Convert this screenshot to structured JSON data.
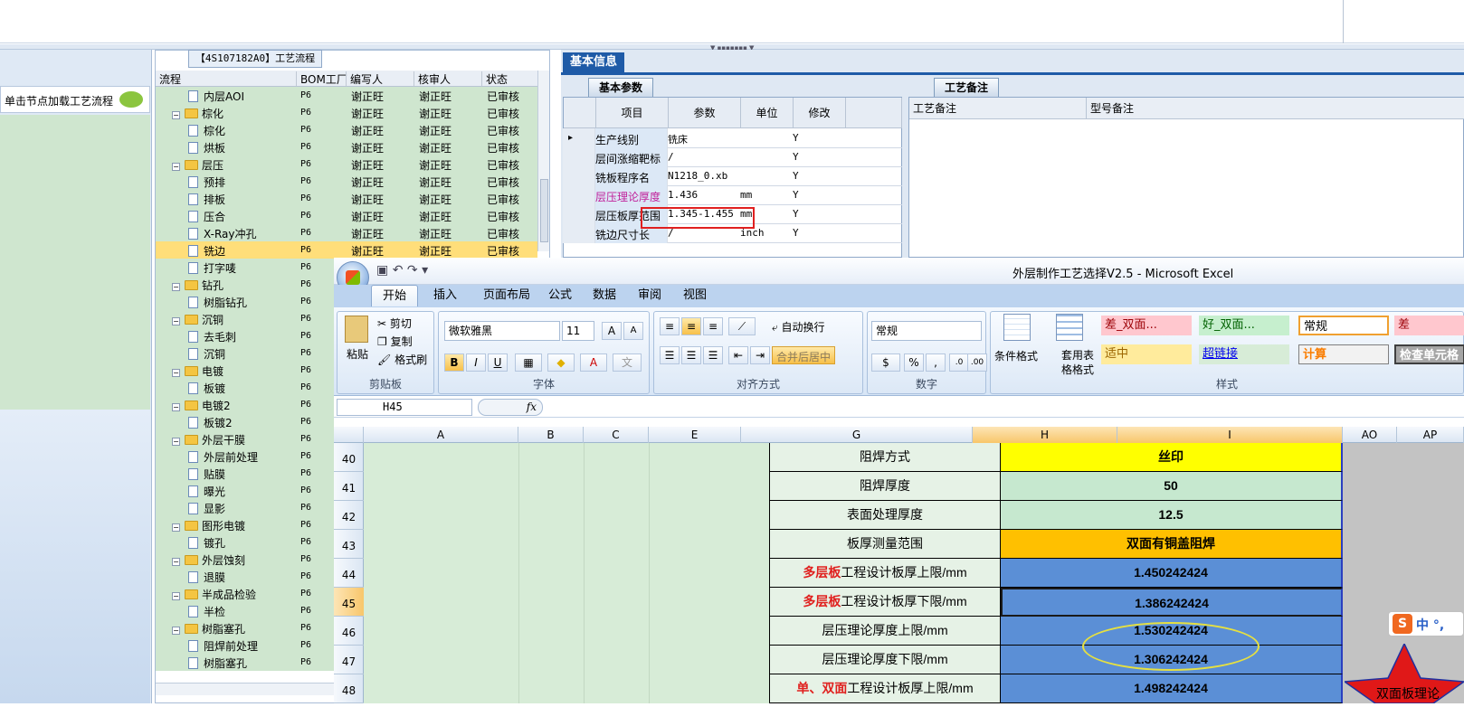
{
  "left_panel": {
    "hint": "单击节点加载工艺流程"
  },
  "tree": {
    "title": "【4S107182A0】工艺流程",
    "columns": [
      "流程",
      "BOM工厂",
      "编写人",
      "核审人",
      "状态"
    ],
    "rows": [
      {
        "name": "内层AOI",
        "type": "doc",
        "level": 2,
        "bom": "P6",
        "writer": "谢正旺",
        "reviewer": "谢正旺",
        "status": "已审核"
      },
      {
        "name": "棕化",
        "type": "folder",
        "level": 1,
        "bom": "P6",
        "writer": "谢正旺",
        "reviewer": "谢正旺",
        "status": "已审核"
      },
      {
        "name": "棕化",
        "type": "doc",
        "level": 2,
        "bom": "P6",
        "writer": "谢正旺",
        "reviewer": "谢正旺",
        "status": "已审核"
      },
      {
        "name": "烘板",
        "type": "doc",
        "level": 2,
        "bom": "P6",
        "writer": "谢正旺",
        "reviewer": "谢正旺",
        "status": "已审核"
      },
      {
        "name": "层压",
        "type": "folder",
        "level": 1,
        "bom": "P6",
        "writer": "谢正旺",
        "reviewer": "谢正旺",
        "status": "已审核"
      },
      {
        "name": "预排",
        "type": "doc",
        "level": 2,
        "bom": "P6",
        "writer": "谢正旺",
        "reviewer": "谢正旺",
        "status": "已审核"
      },
      {
        "name": "排板",
        "type": "doc",
        "level": 2,
        "bom": "P6",
        "writer": "谢正旺",
        "reviewer": "谢正旺",
        "status": "已审核"
      },
      {
        "name": "压合",
        "type": "doc",
        "level": 2,
        "bom": "P6",
        "writer": "谢正旺",
        "reviewer": "谢正旺",
        "status": "已审核"
      },
      {
        "name": "X-Ray冲孔",
        "type": "doc",
        "level": 2,
        "bom": "P6",
        "writer": "谢正旺",
        "reviewer": "谢正旺",
        "status": "已审核"
      },
      {
        "name": "铣边",
        "type": "doc",
        "level": 2,
        "bom": "P6",
        "writer": "谢正旺",
        "reviewer": "谢正旺",
        "status": "已审核",
        "selected": true
      },
      {
        "name": "打字唛",
        "type": "doc",
        "level": 2,
        "bom": "P6",
        "writer": "",
        "reviewer": "",
        "status": ""
      },
      {
        "name": "钻孔",
        "type": "folder",
        "level": 1,
        "bom": "P6",
        "writer": "",
        "reviewer": "",
        "status": ""
      },
      {
        "name": "树脂钻孔",
        "type": "doc",
        "level": 2,
        "bom": "P6",
        "writer": "",
        "reviewer": "",
        "status": ""
      },
      {
        "name": "沉铜",
        "type": "folder",
        "level": 1,
        "bom": "P6",
        "writer": "",
        "reviewer": "",
        "status": ""
      },
      {
        "name": "去毛刺",
        "type": "doc",
        "level": 2,
        "bom": "P6",
        "writer": "",
        "reviewer": "",
        "status": ""
      },
      {
        "name": "沉铜",
        "type": "doc",
        "level": 2,
        "bom": "P6",
        "writer": "",
        "reviewer": "",
        "status": ""
      },
      {
        "name": "电镀",
        "type": "folder",
        "level": 1,
        "bom": "P6",
        "writer": "",
        "reviewer": "",
        "status": ""
      },
      {
        "name": "板镀",
        "type": "doc",
        "level": 2,
        "bom": "P6",
        "writer": "",
        "reviewer": "",
        "status": ""
      },
      {
        "name": "电镀2",
        "type": "folder",
        "level": 1,
        "bom": "P6",
        "writer": "",
        "reviewer": "",
        "status": ""
      },
      {
        "name": "板镀2",
        "type": "doc",
        "level": 2,
        "bom": "P6",
        "writer": "",
        "reviewer": "",
        "status": ""
      },
      {
        "name": "外层干膜",
        "type": "folder",
        "level": 1,
        "bom": "P6",
        "writer": "",
        "reviewer": "",
        "status": ""
      },
      {
        "name": "外层前处理",
        "type": "doc",
        "level": 2,
        "bom": "P6",
        "writer": "",
        "reviewer": "",
        "status": ""
      },
      {
        "name": "贴膜",
        "type": "doc",
        "level": 2,
        "bom": "P6",
        "writer": "",
        "reviewer": "",
        "status": ""
      },
      {
        "name": "曝光",
        "type": "doc",
        "level": 2,
        "bom": "P6",
        "writer": "",
        "reviewer": "",
        "status": ""
      },
      {
        "name": "显影",
        "type": "doc",
        "level": 2,
        "bom": "P6",
        "writer": "",
        "reviewer": "",
        "status": ""
      },
      {
        "name": "图形电镀",
        "type": "folder",
        "level": 1,
        "bom": "P6",
        "writer": "",
        "reviewer": "",
        "status": ""
      },
      {
        "name": "镀孔",
        "type": "doc",
        "level": 2,
        "bom": "P6",
        "writer": "",
        "reviewer": "",
        "status": ""
      },
      {
        "name": "外层蚀刻",
        "type": "folder",
        "level": 1,
        "bom": "P6",
        "writer": "",
        "reviewer": "",
        "status": ""
      },
      {
        "name": "退膜",
        "type": "doc",
        "level": 2,
        "bom": "P6",
        "writer": "",
        "reviewer": "",
        "status": ""
      },
      {
        "name": "半成品检验",
        "type": "folder",
        "level": 1,
        "bom": "P6",
        "writer": "",
        "reviewer": "",
        "status": ""
      },
      {
        "name": "半检",
        "type": "doc",
        "level": 2,
        "bom": "P6",
        "writer": "",
        "reviewer": "",
        "status": ""
      },
      {
        "name": "树脂塞孔",
        "type": "folder",
        "level": 1,
        "bom": "P6",
        "writer": "",
        "reviewer": "",
        "status": ""
      },
      {
        "name": "阻焊前处理",
        "type": "doc",
        "level": 2,
        "bom": "P6",
        "writer": "",
        "reviewer": "",
        "status": ""
      },
      {
        "name": "树脂塞孔",
        "type": "doc",
        "level": 2,
        "bom": "P6",
        "writer": "",
        "reviewer": "",
        "status": ""
      }
    ]
  },
  "info": {
    "main_tab": "基本信息",
    "params_tab": "基本参数",
    "notes_tab": "工艺备注",
    "param_columns": [
      "项目",
      "参数",
      "单位",
      "修改"
    ],
    "params": [
      {
        "item": "生产线别",
        "value": "铣床",
        "unit": "",
        "mod": "Y",
        "current": true
      },
      {
        "item": "层间涨缩靶标",
        "value": "/",
        "unit": "",
        "mod": "Y"
      },
      {
        "item": "铣板程序名",
        "value": "N1218_0.xb",
        "unit": "",
        "mod": "Y"
      },
      {
        "item": "层压理论厚度",
        "value": "1.436",
        "unit": "mm",
        "mod": "Y",
        "pink": true
      },
      {
        "item": "层压板厚范围",
        "value": "1.345-1.455",
        "unit": "mm",
        "mod": "Y"
      },
      {
        "item": "铣边尺寸长",
        "value": "/",
        "unit": "inch",
        "mod": "Y"
      }
    ],
    "notes_columns": [
      "工艺备注",
      "型号备注"
    ]
  },
  "excel": {
    "title": "外层制作工艺选择V2.5 - Microsoft Excel",
    "tabs": [
      "开始",
      "插入",
      "页面布局",
      "公式",
      "数据",
      "审阅",
      "视图"
    ],
    "clipboard": {
      "paste": "粘贴",
      "cut": "剪切",
      "copy": "复制",
      "format_painter": "格式刷",
      "label": "剪贴板"
    },
    "font": {
      "name": "微软雅黑",
      "size": "11",
      "label": "字体"
    },
    "align": {
      "wrap": "自动换行",
      "merge": "合并后居中",
      "label": "对齐方式"
    },
    "number": {
      "format": "常规",
      "label": "数字"
    },
    "styles": {
      "cond": "条件格式",
      "table": "套用表格格式",
      "label": "样式",
      "cells": [
        {
          "text": "差_双面...",
          "bg": "#ffc7ce",
          "fg": "#9c0006"
        },
        {
          "text": "好_双面...",
          "bg": "#c6efce",
          "fg": "#006100"
        },
        {
          "text": "常规",
          "bg": "#ffffff",
          "fg": "#000000"
        },
        {
          "text": "差",
          "bg": "#ffc7ce",
          "fg": "#9c0006"
        },
        {
          "text": "适中",
          "bg": "#ffeb9c",
          "fg": "#9c6500"
        },
        {
          "text": "超链接",
          "bg": "#d7ecd7",
          "fg": "#0000ee"
        },
        {
          "text": "计算",
          "bg": "#f2f2f2",
          "fg": "#fa7d00"
        },
        {
          "text": "检查单元格",
          "bg": "#a5a5a5",
          "fg": "#ffffff"
        }
      ]
    },
    "name_box": "H45",
    "fx": "fx",
    "columns": [
      "A",
      "B",
      "C",
      "E",
      "G",
      "H",
      "I",
      "AO",
      "AP"
    ],
    "row_numbers": [
      "40",
      "41",
      "42",
      "43",
      "44",
      "45",
      "46",
      "47",
      "48"
    ],
    "rows": [
      {
        "red": "",
        "label": "阻焊方式",
        "value": "丝印",
        "bg": "#ffff00"
      },
      {
        "red": "",
        "label": "阻焊厚度",
        "value": "50",
        "bg": "#c6e8cf"
      },
      {
        "red": "",
        "label": "表面处理厚度",
        "value": "12.5",
        "bg": "#c6e8cf"
      },
      {
        "red": "",
        "label": "板厚测量范围",
        "value": "双面有铜盖阻焊",
        "bg": "#ffc000"
      },
      {
        "red": "多层板",
        "label": "工程设计板厚上限/mm",
        "value": "1.450242424",
        "bg": "#5b8fd6"
      },
      {
        "red": "多层板",
        "label": "工程设计板厚下限/mm",
        "value": "1.386242424",
        "bg": "#5b8fd6"
      },
      {
        "red": "",
        "label": "层压理论厚度上限/mm",
        "value": "1.530242424",
        "bg": "#5b8fd6"
      },
      {
        "red": "",
        "label": "层压理论厚度下限/mm",
        "value": "1.306242424",
        "bg": "#5b8fd6"
      },
      {
        "red": "单、双面",
        "label": "工程设计板厚上限/mm",
        "value": "1.498242424",
        "bg": "#5b8fd6"
      }
    ],
    "sogou": {
      "logo": "S",
      "text": "中 °,"
    },
    "star_text": "双面板理论"
  }
}
